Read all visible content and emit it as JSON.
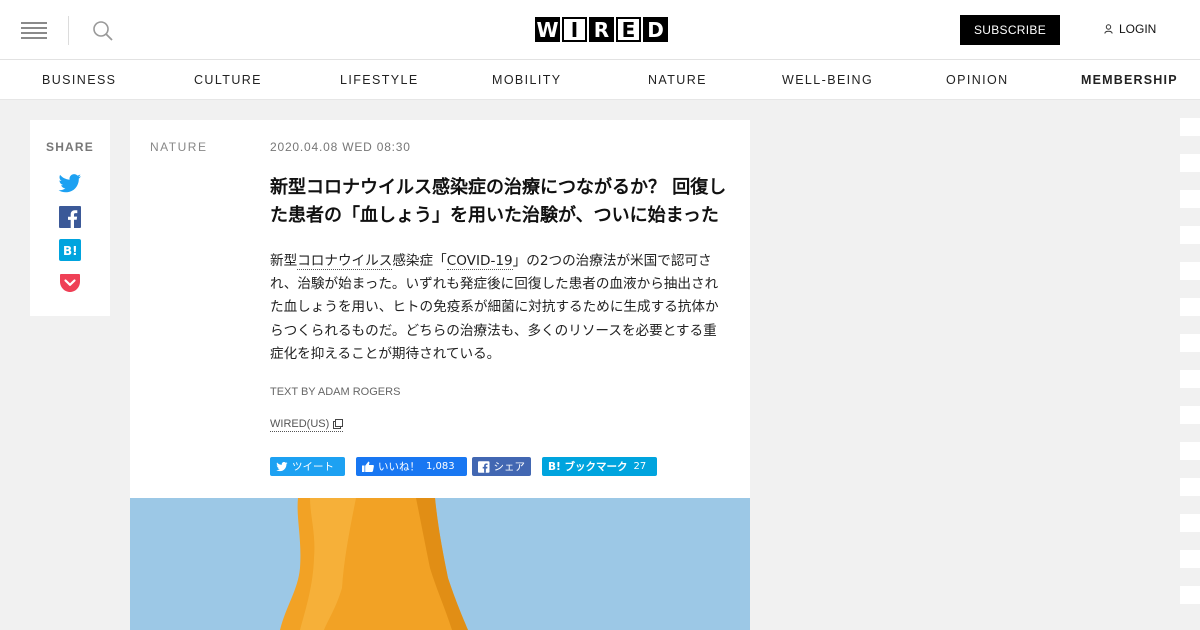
{
  "header": {
    "logo_letters": [
      "W",
      "I",
      "R",
      "E",
      "D"
    ],
    "subscribe_label": "SUBSCRIBE",
    "login_label": "LOGIN"
  },
  "nav": {
    "items": [
      "BUSINESS",
      "CULTURE",
      "LIFESTYLE",
      "MOBILITY",
      "NATURE",
      "WELL-BEING",
      "OPINION",
      "MEMBERSHIP"
    ]
  },
  "share": {
    "label": "SHARE",
    "icons": [
      "twitter-icon",
      "facebook-icon",
      "hatena-bookmark-icon",
      "pocket-icon"
    ]
  },
  "article": {
    "category": "NATURE",
    "date": "2020.04.08 WED 08:30",
    "title": "新型コロナウイルス感染症の治療につながるか？ 回復した患者の「血しょう」を用いた治験が、ついに始まった",
    "lead": {
      "p1": "新型",
      "link1": "コロナウイルス",
      "p2": "感染症「",
      "link2": "COVID-19",
      "p3": "」の2つの治療法が米国で認可され、治験が始まった。いずれも発症後に回復した患者の血液から抽出された血しょうを用い、ヒトの免疫系が細菌に対抗するために生成する抗体からつくられるものだ。どちらの治療法も、多くのリソースを必要とする重症化を抑えることが期待されている。"
    },
    "byline": "TEXT BY ADAM ROGERS",
    "source": "WIRED(US)"
  },
  "social_buttons": {
    "tweet": "ツイート",
    "like": "いいね！",
    "like_count": "1,083",
    "share": "シェア",
    "bookmark": "B! ブックマーク",
    "bookmark_count": "27"
  },
  "colors": {
    "twitter": "#1da1f2",
    "facebook_like": "#1877f2",
    "facebook_share": "#4267b2",
    "hatena": "#00a4de",
    "pocket": "#ef4056",
    "hero_bg": "#9cc8e6",
    "hero_liquid": "#f2a225"
  }
}
